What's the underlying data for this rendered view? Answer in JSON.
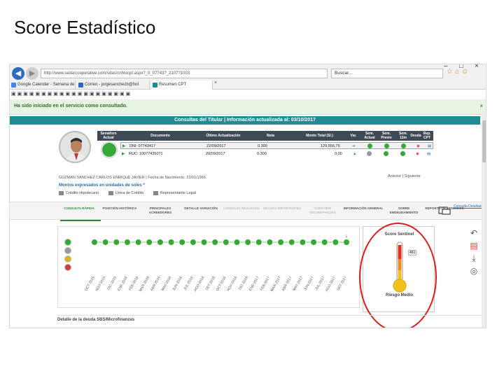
{
  "slide": {
    "title": "Score Estadístico"
  },
  "browser": {
    "url": "http://www.sedarcooperative.com/sdas/cnhtocpt.aspx?_0_07743?_2107?1003",
    "search_placeholder": "Buscar...",
    "tabs": [
      {
        "label": "Google Calendar - Semana de",
        "favicon_color": "#4285f4"
      },
      {
        "label": "Correo - jorgesanchezb@hot",
        "favicon_color": "#2a6bbf"
      },
      {
        "label": "Resumen CPT",
        "favicon_color": "#1e8c93"
      }
    ],
    "tab_close": "×"
  },
  "notice": {
    "text": "Ha sido iniciado en el servicio como consultado.",
    "close": "×"
  },
  "header_bar": {
    "text": "Consultas del Titular | Información actualizada al: 03/10/2017"
  },
  "table": {
    "columns": [
      "Semáforo Actual",
      "Documento",
      "Último Actualización",
      "Nota",
      "Monto Total (S/.)",
      "Var.",
      "Sem. Actual",
      "Sem. Previo",
      "Sem. 12m",
      "Deuda",
      "Rep. CPT"
    ],
    "rows": [
      {
        "doc": "DNI: 07743417",
        "fecha": "22/09/2017",
        "nota": "0.300",
        "monto": "129,556.79",
        "var_icon": "green-arrow-right"
      },
      {
        "doc": "RUC: 10077435071",
        "fecha": "20/09/2017",
        "nota": "0.300",
        "monto": "0.00",
        "var_icon": "green-triangle-up"
      }
    ]
  },
  "person_line": "GUZMAN SANCHEZ CARLOS ENRIQUE JAVIER | Fecha de Nacimiento: 22/01/1966",
  "pager": {
    "prev": "Anterior",
    "next": "Siguiente",
    "sep": "|"
  },
  "montos_label": "Montos expresados en unidades de soles *",
  "legend": [
    "Crédito Hipotecario",
    "Línea de Crédito",
    "Representante Legal"
  ],
  "sections": [
    {
      "label": "CONSULTA RÁPIDA",
      "state": "active"
    },
    {
      "label": "POSICIÓN HISTÓRICA",
      "state": "normal"
    },
    {
      "label": "PRINCIPALES ACREEDORES",
      "state": "normal"
    },
    {
      "label": "DETALLE VARIACIÓN",
      "state": "normal"
    },
    {
      "label": "CONSULTA REALIZADA",
      "state": "disabled"
    },
    {
      "label": "HECHOS IMPORTANTES",
      "state": "disabled"
    },
    {
      "label": "OVERVIEW DISCREPANCIAS",
      "state": "disabled"
    },
    {
      "label": "INFORMACIÓN GENERAL",
      "state": "normal"
    },
    {
      "label": "SOBRE ENDEUDAMIENTO",
      "state": "normal"
    },
    {
      "label": "REPORTE DE VENCIDOS",
      "state": "normal"
    }
  ],
  "consulta_detallada": "Consulta Detallada",
  "chart_data": {
    "type": "scatter",
    "title": "",
    "categories": [
      "OCT-2015",
      "NOV-2015",
      "DIC-2015",
      "ENE-2016",
      "FEB-2016",
      "MAR-2016",
      "ABR-2016",
      "MAY-2016",
      "JUN-2016",
      "JUL-2016",
      "AGO-2016",
      "SET-2016",
      "OCT-2016",
      "NOV-2016",
      "DIC-2016",
      "ENE-2017",
      "FEB-2017",
      "MAR-2017",
      "ABR-2017",
      "MAY-2017",
      "JUN-2017",
      "JUL-2017",
      "AGO-2017",
      "SET-2017"
    ],
    "levels": [
      "green",
      "gray",
      "yellow",
      "red"
    ],
    "series": [
      {
        "values": [
          "green",
          "green",
          "green",
          "green",
          "green",
          "green",
          "green",
          "green",
          "green",
          "green",
          "green",
          "green",
          "green",
          "green",
          "green",
          "green",
          "green",
          "green",
          "green",
          "green",
          "green",
          "green",
          "green",
          "green"
        ]
      }
    ],
    "legend_dots": [
      "#35a836",
      "#9a9a9a",
      "#e0b21a",
      "#d23b3b"
    ],
    "grid": false
  },
  "sentinel": {
    "title": "Score Sentinel",
    "value": "461",
    "label": "Riesgo Medio",
    "level_color": "#e0b21a"
  },
  "footer": "Detalle de la deuda SBS/Microfinanzas",
  "colors": {
    "teal": "#1e8c93",
    "header": "#3f4a57",
    "green": "#35a836",
    "highlight": "#e01b1b"
  }
}
